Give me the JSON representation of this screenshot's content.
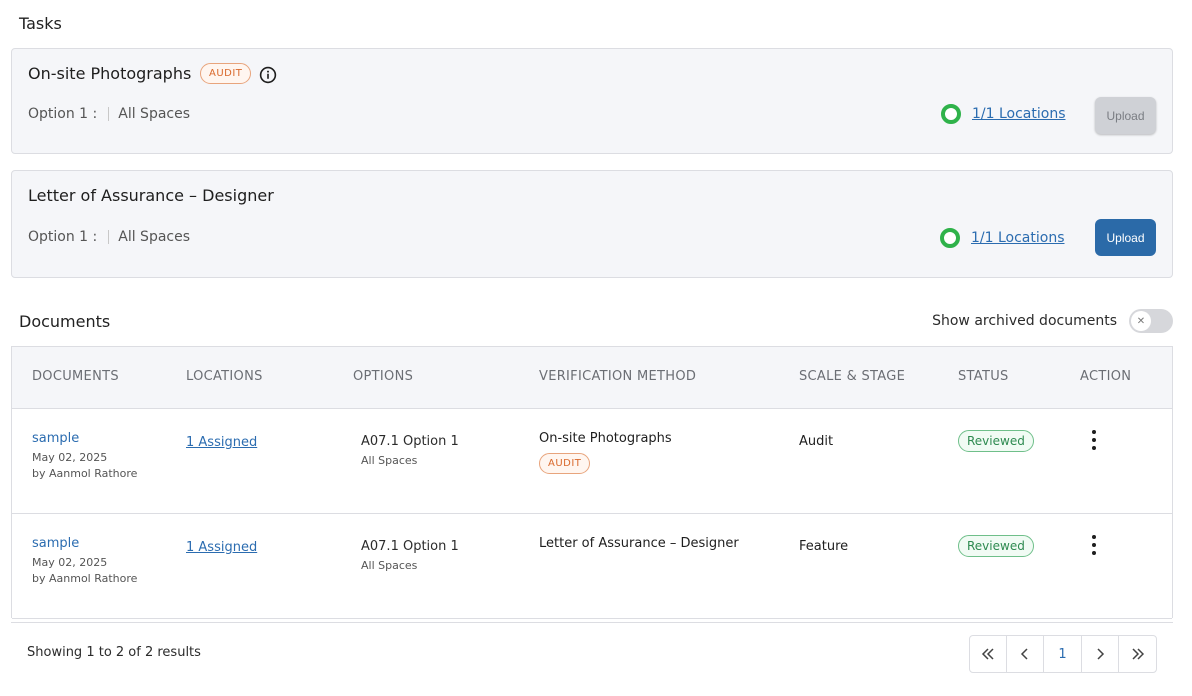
{
  "tasks_title": "Tasks",
  "tasks": [
    {
      "name": "On-site Photographs",
      "badge": "AUDIT",
      "option_label": "Option 1 :",
      "spaces": "All Spaces",
      "locations": "1/1 Locations",
      "upload_label": "Upload",
      "upload_enabled": false
    },
    {
      "name": "Letter of Assurance – Designer",
      "option_label": "Option 1 :",
      "spaces": "All Spaces",
      "locations": "1/1 Locations",
      "upload_label": "Upload",
      "upload_enabled": true
    }
  ],
  "documents_title": "Documents",
  "archived_toggle_label": "Show archived documents",
  "archived_toggle_on": false,
  "table": {
    "headers": [
      "DOCUMENTS",
      "LOCATIONS",
      "OPTIONS",
      "VERIFICATION METHOD",
      "SCALE & STAGE",
      "STATUS",
      "ACTION"
    ],
    "rows": [
      {
        "doc_name": "sample",
        "date": "May 02, 2025",
        "by": "by Aanmol Rathore",
        "locations": "1 Assigned",
        "option": "A07.1 Option 1",
        "option_sub": "All Spaces",
        "verification": "On-site Photographs",
        "verification_badge": "AUDIT",
        "scale": "Audit",
        "status": "Reviewed"
      },
      {
        "doc_name": "sample",
        "date": "May 02, 2025",
        "by": "by Aanmol Rathore",
        "locations": "1 Assigned",
        "option": "A07.1 Option 1",
        "option_sub": "All Spaces",
        "verification": "Letter of Assurance – Designer",
        "scale": "Feature",
        "status": "Reviewed"
      }
    ]
  },
  "pagination": {
    "showing": "Showing 1 to 2 of 2 results",
    "current_page": "1"
  },
  "colors": {
    "link": "#2b6cb0",
    "primary_button": "#2b6aa8",
    "success_ring": "#2fb24a",
    "audit_badge": "#d9692c",
    "reviewed_badge": "#2e8a50"
  }
}
